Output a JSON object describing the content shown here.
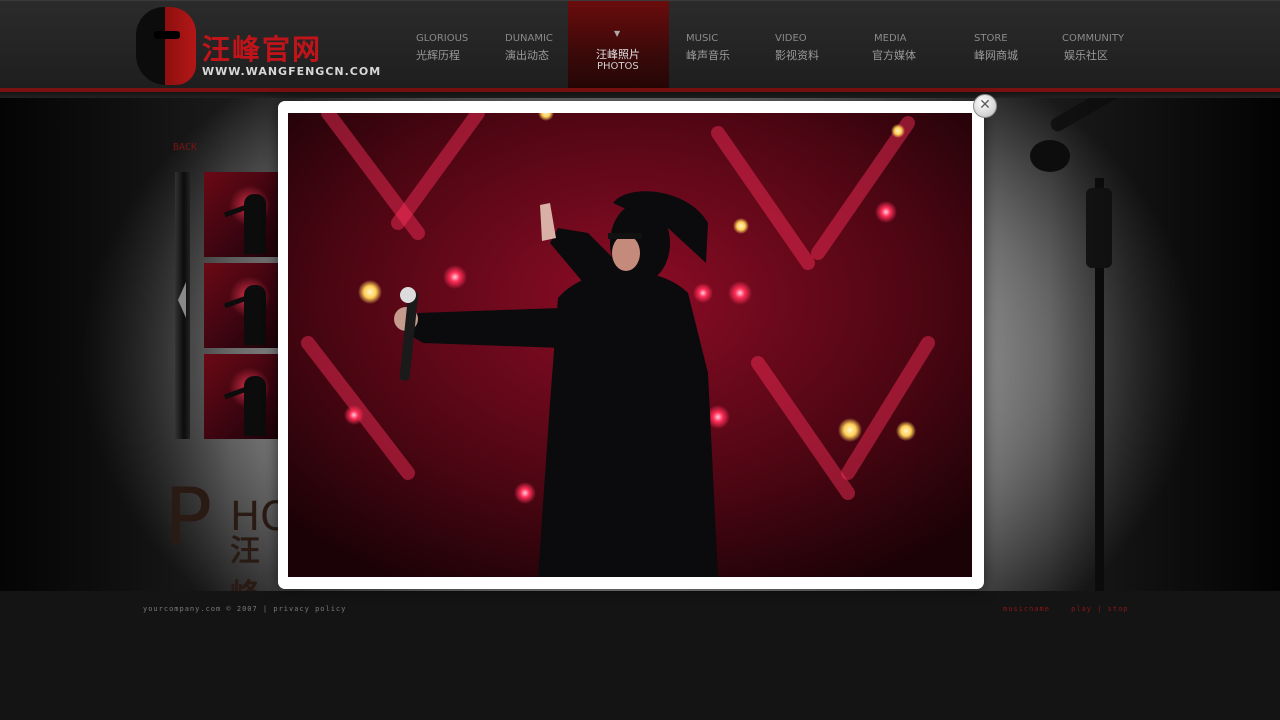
{
  "logo": {
    "title": "汪峰官网",
    "url": "WWW.WANGFENGCN.COM"
  },
  "nav": [
    {
      "en": "GLORIOUS",
      "zh": "光辉历程"
    },
    {
      "en": "DUNAMIC",
      "zh": "演出动态"
    },
    {
      "en": "PHOTOS",
      "zh": "汪峰照片",
      "active": true
    },
    {
      "en": "MUSIC",
      "zh": "峰声音乐"
    },
    {
      "en": "VIDEO",
      "zh": "影视资料"
    },
    {
      "en": "MEDIA",
      "zh": "官方媒体"
    },
    {
      "en": "STORE",
      "zh": "峰网商城"
    },
    {
      "en": "COMMUNITY",
      "zh": "娱乐社区"
    }
  ],
  "gallery": {
    "back_label": "BACK",
    "heading_big": "P",
    "heading_rest": "HO",
    "heading_cn": "汪峰"
  },
  "footer": {
    "copyright": "yourcompany.com © 2007 | privacy policy",
    "music_name": "musicname",
    "play_stop": "play | stop"
  },
  "modal": {
    "close_icon": "close-icon",
    "photo_subject": "concert-photo-singer-thumbs-up"
  },
  "colors": {
    "accent": "#7a1010",
    "nav_active": "#6a0c0c",
    "stage_red": "#b3102e"
  }
}
